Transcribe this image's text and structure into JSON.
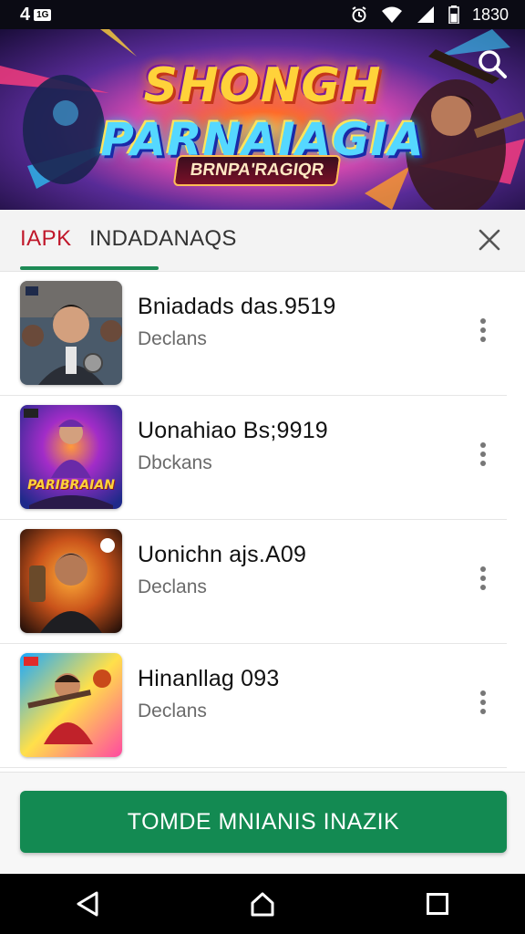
{
  "status_bar": {
    "left_text": "4",
    "badge": "1G",
    "time": "1830",
    "icons": [
      "alarm-icon",
      "wifi-icon",
      "signal-icon",
      "battery-icon"
    ]
  },
  "banner": {
    "title_line1": "SHONGH",
    "title_line2": "PARNAIAGIA",
    "subtitle": "BRNPA'RAGIQR"
  },
  "tabs": [
    {
      "label": "IAPK",
      "active": true
    },
    {
      "label": "INDADANAQS",
      "active": false
    }
  ],
  "list_items": [
    {
      "title": "Bniadads das.9519",
      "subtitle": "Declans"
    },
    {
      "title": "Uonahiao Bs;9919",
      "subtitle": "Dbckans",
      "thumb_text": "PARIBRAIAN"
    },
    {
      "title": "Uonichn ajs.A09",
      "subtitle": "Declans"
    },
    {
      "title": "Hinanllag 093",
      "subtitle": "Declans"
    }
  ],
  "primary_button": "TOMDE MNIANIS INAZIK",
  "colors": {
    "accent_red": "#c0172a",
    "accent_green": "#138a52",
    "tab_underline": "#1d8a55"
  }
}
